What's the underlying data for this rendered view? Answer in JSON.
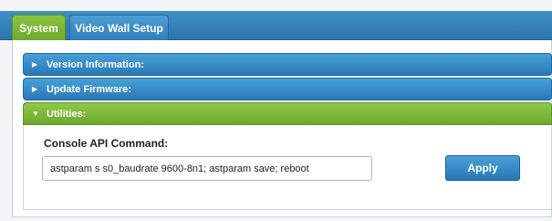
{
  "tabs": [
    {
      "label": "System",
      "active": true
    },
    {
      "label": "Video Wall Setup",
      "active": false
    }
  ],
  "sections": [
    {
      "label": "Version Information:",
      "expanded": false,
      "arrow_icon": "triangle-right-icon"
    },
    {
      "label": "Update Firmware:",
      "expanded": false,
      "arrow_icon": "triangle-right-icon"
    },
    {
      "label": "Utilities:",
      "expanded": true,
      "arrow_icon": "triangle-down-icon"
    }
  ],
  "utilities": {
    "console_label": "Console API Command:",
    "console_value": "astparam s s0_baudrate 9600-8n1; astparam save; reboot",
    "apply_label": "Apply"
  },
  "colors": {
    "tab_active": "#7bb534",
    "tab_bar": "#3585c1",
    "section_blue": "#3a8cc9",
    "section_green": "#7fbb3c"
  }
}
